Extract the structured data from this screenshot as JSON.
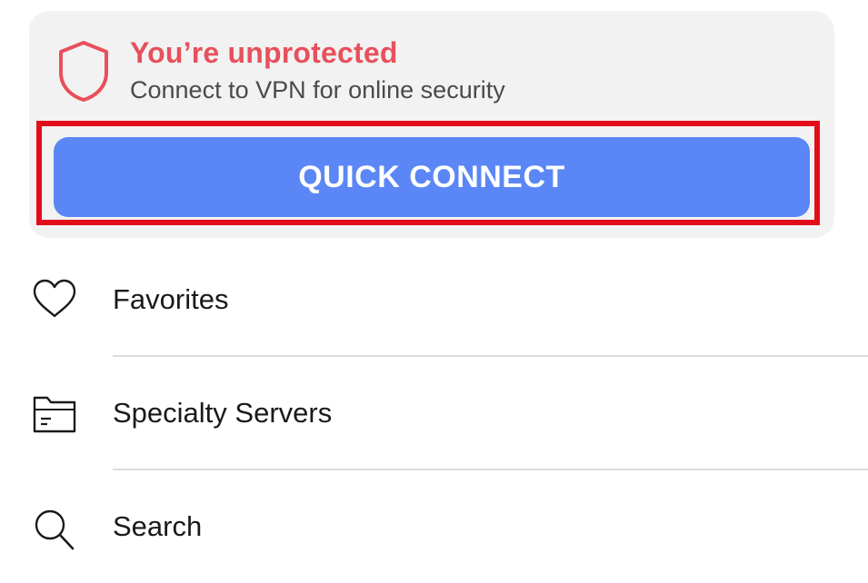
{
  "status": {
    "title": "You’re unprotected",
    "subtitle": "Connect to VPN for online security",
    "icon": "shield-icon",
    "title_color": "#e8505b"
  },
  "quick_connect": {
    "label": "QUICK CONNECT",
    "color": "#5a87f5"
  },
  "menu": {
    "items": [
      {
        "label": "Favorites",
        "icon": "heart-icon"
      },
      {
        "label": "Specialty Servers",
        "icon": "folder-icon"
      },
      {
        "label": "Search",
        "icon": "search-icon"
      }
    ]
  },
  "highlight_color": "#e30d1a"
}
